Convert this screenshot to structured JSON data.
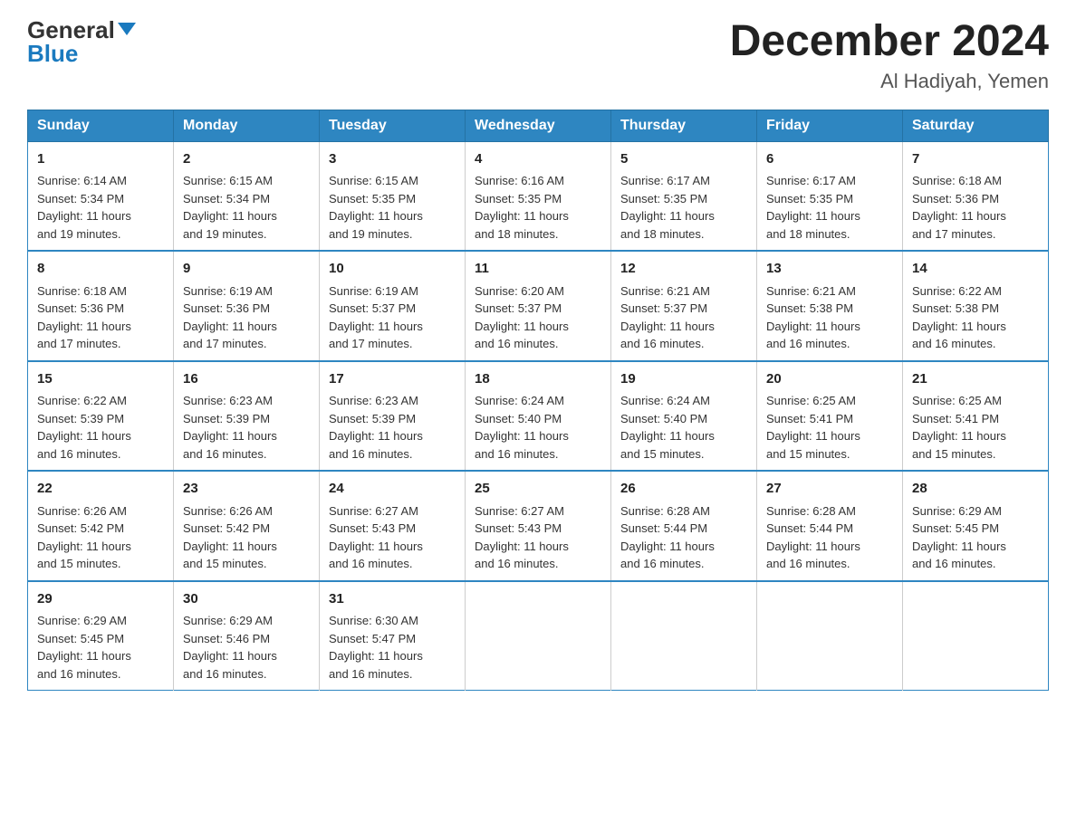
{
  "header": {
    "logo_general": "General",
    "logo_blue": "Blue",
    "month_title": "December 2024",
    "location": "Al Hadiyah, Yemen"
  },
  "weekdays": [
    "Sunday",
    "Monday",
    "Tuesday",
    "Wednesday",
    "Thursday",
    "Friday",
    "Saturday"
  ],
  "weeks": [
    [
      {
        "day": "1",
        "sunrise": "6:14 AM",
        "sunset": "5:34 PM",
        "daylight": "11 hours and 19 minutes."
      },
      {
        "day": "2",
        "sunrise": "6:15 AM",
        "sunset": "5:34 PM",
        "daylight": "11 hours and 19 minutes."
      },
      {
        "day": "3",
        "sunrise": "6:15 AM",
        "sunset": "5:35 PM",
        "daylight": "11 hours and 19 minutes."
      },
      {
        "day": "4",
        "sunrise": "6:16 AM",
        "sunset": "5:35 PM",
        "daylight": "11 hours and 18 minutes."
      },
      {
        "day": "5",
        "sunrise": "6:17 AM",
        "sunset": "5:35 PM",
        "daylight": "11 hours and 18 minutes."
      },
      {
        "day": "6",
        "sunrise": "6:17 AM",
        "sunset": "5:35 PM",
        "daylight": "11 hours and 18 minutes."
      },
      {
        "day": "7",
        "sunrise": "6:18 AM",
        "sunset": "5:36 PM",
        "daylight": "11 hours and 17 minutes."
      }
    ],
    [
      {
        "day": "8",
        "sunrise": "6:18 AM",
        "sunset": "5:36 PM",
        "daylight": "11 hours and 17 minutes."
      },
      {
        "day": "9",
        "sunrise": "6:19 AM",
        "sunset": "5:36 PM",
        "daylight": "11 hours and 17 minutes."
      },
      {
        "day": "10",
        "sunrise": "6:19 AM",
        "sunset": "5:37 PM",
        "daylight": "11 hours and 17 minutes."
      },
      {
        "day": "11",
        "sunrise": "6:20 AM",
        "sunset": "5:37 PM",
        "daylight": "11 hours and 16 minutes."
      },
      {
        "day": "12",
        "sunrise": "6:21 AM",
        "sunset": "5:37 PM",
        "daylight": "11 hours and 16 minutes."
      },
      {
        "day": "13",
        "sunrise": "6:21 AM",
        "sunset": "5:38 PM",
        "daylight": "11 hours and 16 minutes."
      },
      {
        "day": "14",
        "sunrise": "6:22 AM",
        "sunset": "5:38 PM",
        "daylight": "11 hours and 16 minutes."
      }
    ],
    [
      {
        "day": "15",
        "sunrise": "6:22 AM",
        "sunset": "5:39 PM",
        "daylight": "11 hours and 16 minutes."
      },
      {
        "day": "16",
        "sunrise": "6:23 AM",
        "sunset": "5:39 PM",
        "daylight": "11 hours and 16 minutes."
      },
      {
        "day": "17",
        "sunrise": "6:23 AM",
        "sunset": "5:39 PM",
        "daylight": "11 hours and 16 minutes."
      },
      {
        "day": "18",
        "sunrise": "6:24 AM",
        "sunset": "5:40 PM",
        "daylight": "11 hours and 16 minutes."
      },
      {
        "day": "19",
        "sunrise": "6:24 AM",
        "sunset": "5:40 PM",
        "daylight": "11 hours and 15 minutes."
      },
      {
        "day": "20",
        "sunrise": "6:25 AM",
        "sunset": "5:41 PM",
        "daylight": "11 hours and 15 minutes."
      },
      {
        "day": "21",
        "sunrise": "6:25 AM",
        "sunset": "5:41 PM",
        "daylight": "11 hours and 15 minutes."
      }
    ],
    [
      {
        "day": "22",
        "sunrise": "6:26 AM",
        "sunset": "5:42 PM",
        "daylight": "11 hours and 15 minutes."
      },
      {
        "day": "23",
        "sunrise": "6:26 AM",
        "sunset": "5:42 PM",
        "daylight": "11 hours and 15 minutes."
      },
      {
        "day": "24",
        "sunrise": "6:27 AM",
        "sunset": "5:43 PM",
        "daylight": "11 hours and 16 minutes."
      },
      {
        "day": "25",
        "sunrise": "6:27 AM",
        "sunset": "5:43 PM",
        "daylight": "11 hours and 16 minutes."
      },
      {
        "day": "26",
        "sunrise": "6:28 AM",
        "sunset": "5:44 PM",
        "daylight": "11 hours and 16 minutes."
      },
      {
        "day": "27",
        "sunrise": "6:28 AM",
        "sunset": "5:44 PM",
        "daylight": "11 hours and 16 minutes."
      },
      {
        "day": "28",
        "sunrise": "6:29 AM",
        "sunset": "5:45 PM",
        "daylight": "11 hours and 16 minutes."
      }
    ],
    [
      {
        "day": "29",
        "sunrise": "6:29 AM",
        "sunset": "5:45 PM",
        "daylight": "11 hours and 16 minutes."
      },
      {
        "day": "30",
        "sunrise": "6:29 AM",
        "sunset": "5:46 PM",
        "daylight": "11 hours and 16 minutes."
      },
      {
        "day": "31",
        "sunrise": "6:30 AM",
        "sunset": "5:47 PM",
        "daylight": "11 hours and 16 minutes."
      },
      null,
      null,
      null,
      null
    ]
  ],
  "labels": {
    "sunrise": "Sunrise:",
    "sunset": "Sunset:",
    "daylight": "Daylight:"
  }
}
